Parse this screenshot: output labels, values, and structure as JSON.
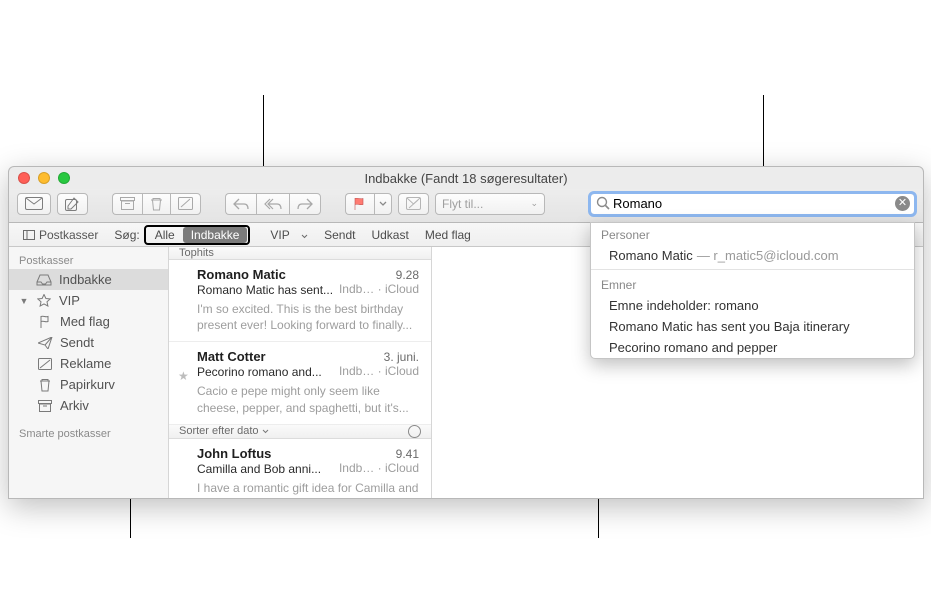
{
  "window": {
    "title": "Indbakke (Fandt 18 søgeresultater)"
  },
  "toolbar": {
    "moveto_placeholder": "Flyt til..."
  },
  "search": {
    "value": "Romano",
    "sections": {
      "people_header": "Personer",
      "subjects_header": "Emner",
      "person_name": "Romano Matic",
      "person_email": "— r_matic5@icloud.com",
      "subj1": "Emne indeholder: romano",
      "subj2": "Romano Matic has sent you Baja itinerary",
      "subj3": "Pecorino romano and pepper"
    }
  },
  "scopebar": {
    "favorites_label": "Postkasser",
    "search_label": "Søg:",
    "scopes": {
      "all": "Alle",
      "inbox": "Indbakke",
      "vip": "VIP",
      "sent": "Sendt",
      "drafts": "Udkast",
      "flagged": "Med flag"
    }
  },
  "sidebar": {
    "header1": "Postkasser",
    "header2": "Smarte postkasser",
    "items": {
      "inbox": "Indbakke",
      "vip": "VIP",
      "flagged": "Med flag",
      "sent": "Sendt",
      "junk": "Reklame",
      "trash": "Papirkurv",
      "archive": "Arkiv"
    }
  },
  "list": {
    "tophits": "Tophits",
    "sort_label": "Sorter efter dato",
    "messages": [
      {
        "from": "Romano Matic",
        "time": "9.28",
        "subject": "Romano Matic has sent...",
        "location": "Indb… · iCloud",
        "preview": "I'm so excited. This is the best birthday present ever! Looking forward to finally..."
      },
      {
        "from": "Matt Cotter",
        "time": "3. juni.",
        "subject": "Pecorino romano and...",
        "location": "Indb… · iCloud",
        "preview": "Cacio e pepe might only seem like cheese, pepper, and spaghetti, but it's...",
        "starred": true
      },
      {
        "from": "John Loftus",
        "time": "9.41",
        "subject": "Camilla and Bob anni...",
        "location": "Indb… · iCloud",
        "preview": "I have a romantic gift idea for Camilla and Bob's anniversary. Let me know..."
      }
    ]
  }
}
